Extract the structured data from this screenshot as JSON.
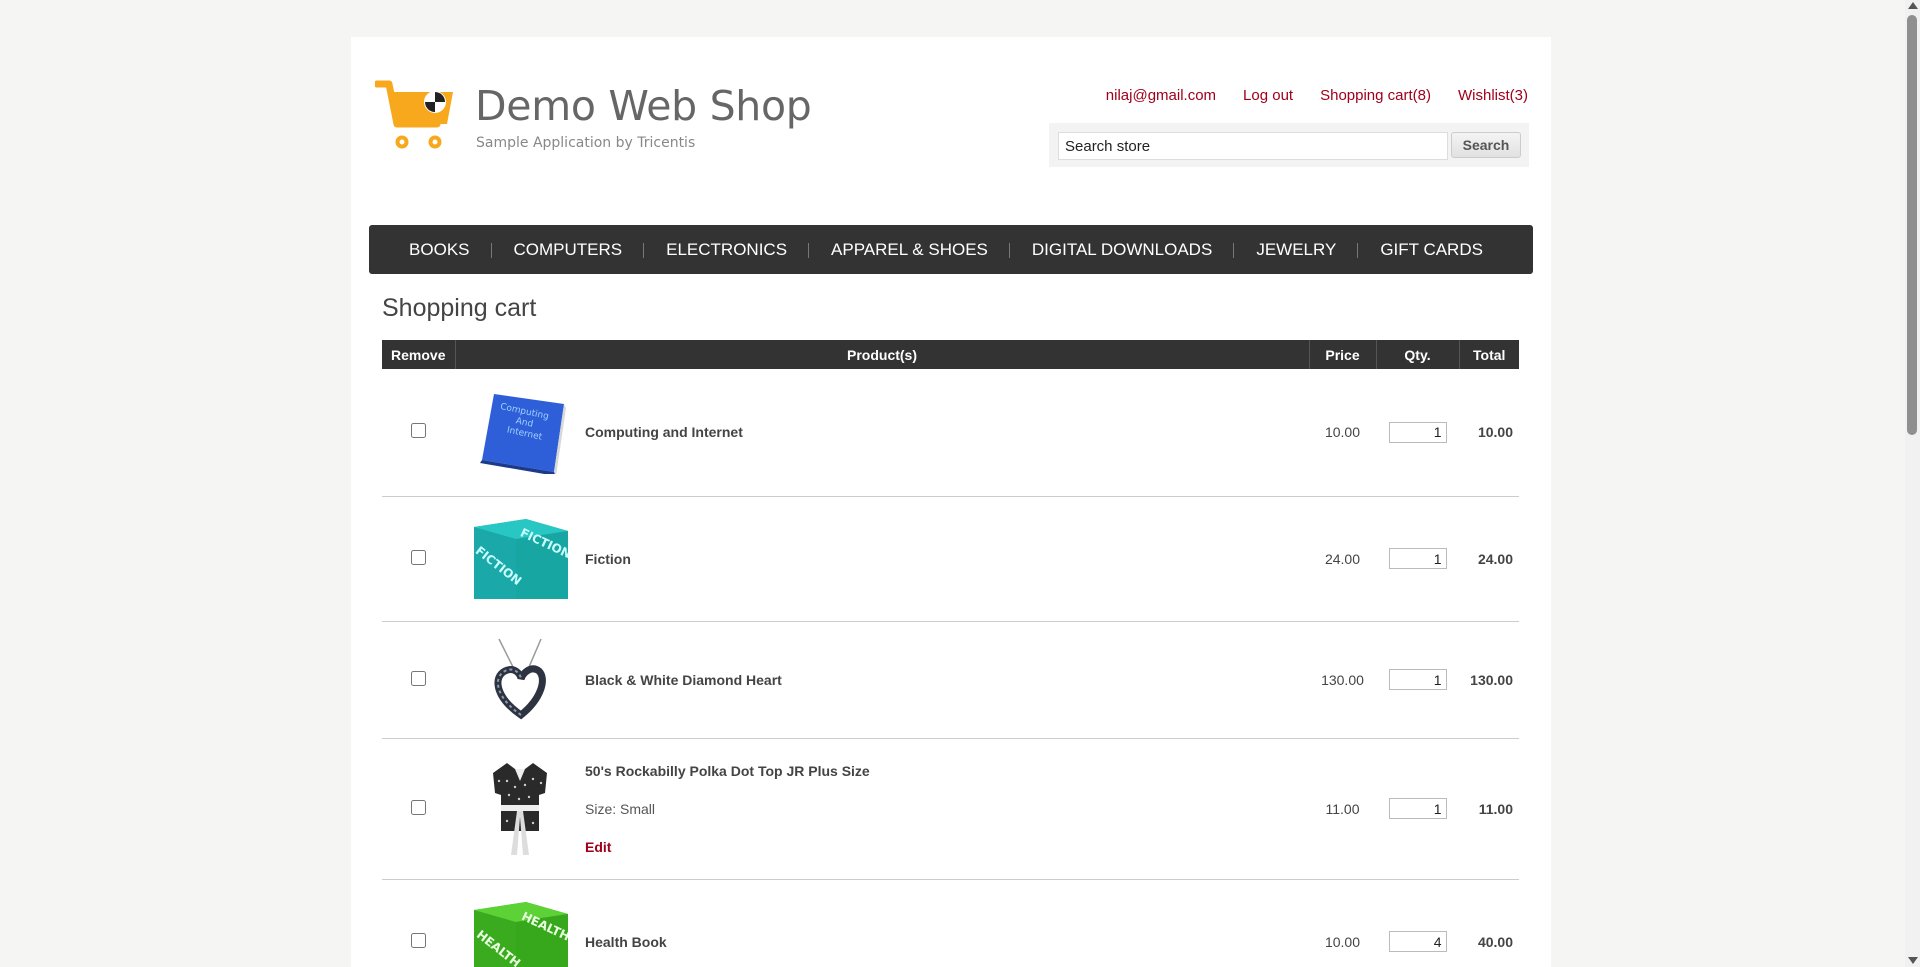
{
  "header": {
    "brand_title": "Demo Web Shop",
    "brand_subtitle": "Sample Application by Tricentis",
    "links": {
      "account": "nilaj@gmail.com",
      "logout": "Log out",
      "cart": "Shopping cart(8)",
      "wishlist": "Wishlist(3)"
    },
    "search": {
      "value": "Search store",
      "button": "Search"
    }
  },
  "menu": [
    "BOOKS",
    "COMPUTERS",
    "ELECTRONICS",
    "APPAREL & SHOES",
    "DIGITAL DOWNLOADS",
    "JEWELRY",
    "GIFT CARDS"
  ],
  "page_title": "Shopping cart",
  "table": {
    "headers": {
      "remove": "Remove",
      "product": "Product(s)",
      "price": "Price",
      "qty": "Qty.",
      "total": "Total"
    },
    "rows": [
      {
        "name": "Computing and Internet",
        "image": "computing-book-icon",
        "price": "10.00",
        "qty": "1",
        "total": "10.00"
      },
      {
        "name": "Fiction",
        "image": "fiction-book-icon",
        "price": "24.00",
        "qty": "1",
        "total": "24.00"
      },
      {
        "name": "Black & White Diamond Heart",
        "image": "heart-pendant-icon",
        "price": "130.00",
        "qty": "1",
        "total": "130.00"
      },
      {
        "name": "50's Rockabilly Polka Dot Top JR Plus Size",
        "image": "polka-top-icon",
        "attribute": "Size: Small",
        "edit": "Edit",
        "price": "11.00",
        "qty": "1",
        "total": "11.00"
      },
      {
        "name": "Health Book",
        "image": "health-book-icon",
        "price": "10.00",
        "qty": "4",
        "total": "40.00"
      }
    ]
  },
  "colors": {
    "link": "#a0001a",
    "menu_bg": "#333333",
    "total": "#2c8f2c",
    "logo_cart": "#f8a81c"
  }
}
